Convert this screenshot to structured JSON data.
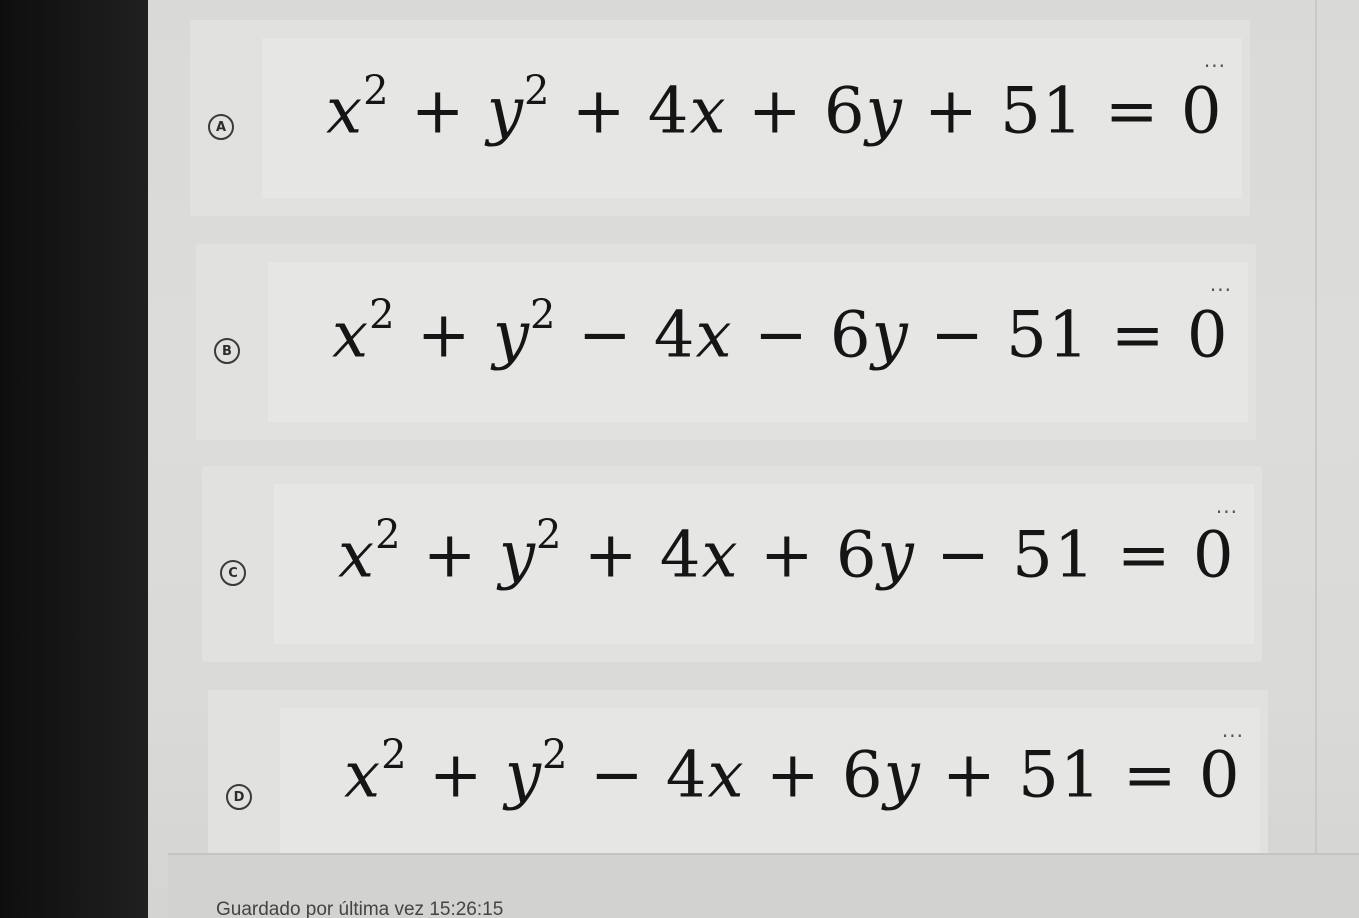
{
  "options": [
    {
      "letter": "A",
      "sign_x": "+",
      "sign_y": "+",
      "sign_c": "+",
      "coef_x": "4",
      "coef_y": "6",
      "constant": "51",
      "rhs": "0",
      "more": "..."
    },
    {
      "letter": "B",
      "sign_x": "−",
      "sign_y": "−",
      "sign_c": "−",
      "coef_x": "4",
      "coef_y": "6",
      "constant": "51",
      "rhs": "0",
      "more": "..."
    },
    {
      "letter": "C",
      "sign_x": "+",
      "sign_y": "+",
      "sign_c": "−",
      "coef_x": "4",
      "coef_y": "6",
      "constant": "51",
      "rhs": "0",
      "more": "..."
    },
    {
      "letter": "D",
      "sign_x": "−",
      "sign_y": "+",
      "sign_c": "+",
      "coef_x": "4",
      "coef_y": "6",
      "constant": "51",
      "rhs": "0",
      "more": "..."
    }
  ],
  "footer": {
    "saved_label": "Guardado por última vez 15:26:15"
  },
  "colors": {
    "background": "#dadad8",
    "card": "#e1e1df",
    "text": "#151515"
  }
}
